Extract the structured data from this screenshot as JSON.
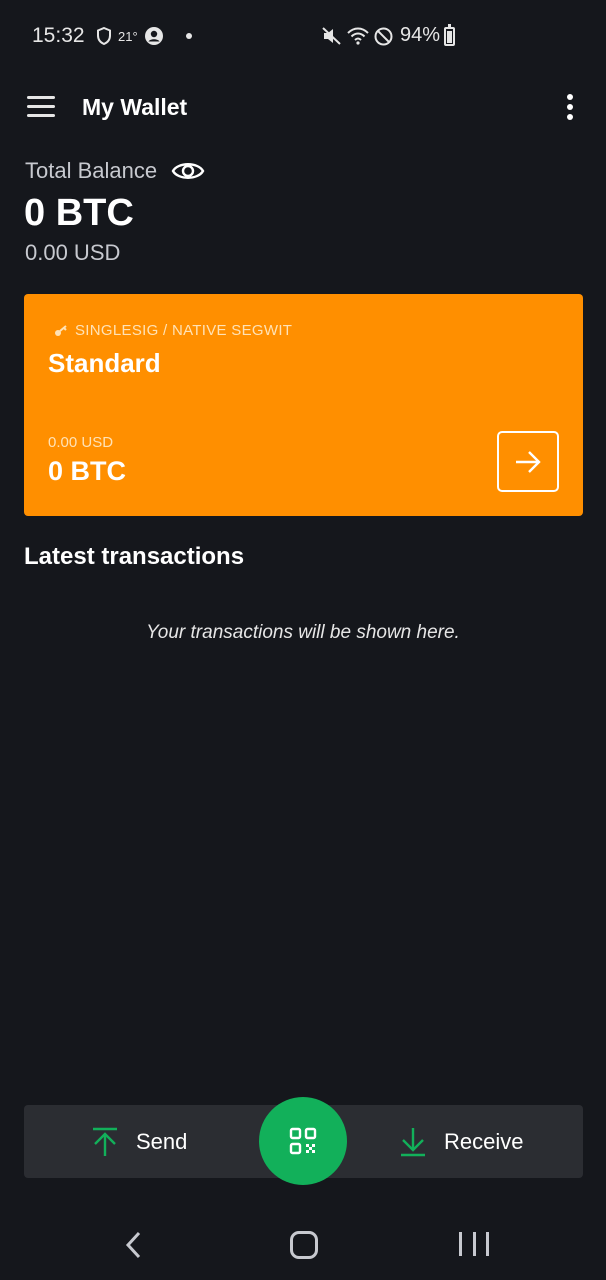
{
  "status_bar": {
    "time": "15:32",
    "temperature": "21°",
    "battery": "94%",
    "icons": [
      "shield-icon",
      "account-circle-icon",
      "mute-icon",
      "wifi-icon",
      "do-not-disturb-icon",
      "battery-icon"
    ]
  },
  "app_bar": {
    "title": "My Wallet"
  },
  "balance": {
    "label": "Total Balance",
    "btc": "0 BTC",
    "usd": "0.00 USD"
  },
  "wallet_card": {
    "type": "SINGLESIG / NATIVE SEGWIT",
    "name": "Standard",
    "usd": "0.00 USD",
    "btc": "0 BTC",
    "color": "#ff8f00"
  },
  "transactions": {
    "title": "Latest transactions",
    "empty_message": "Your transactions will be shown here."
  },
  "actions": {
    "send_label": "Send",
    "receive_label": "Receive",
    "accent_color": "#12b05a"
  }
}
